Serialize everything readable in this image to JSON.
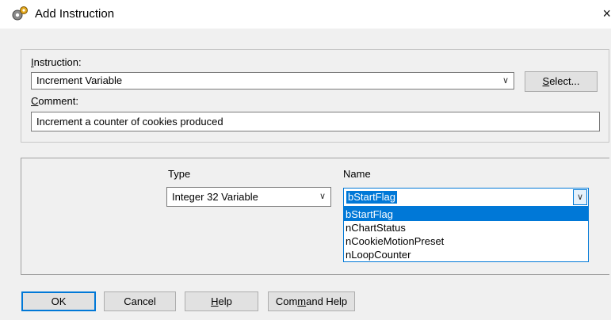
{
  "window": {
    "title": "Add Instruction",
    "close_glyph": "×"
  },
  "instruction": {
    "label_underlined": "I",
    "label_rest": "nstruction:",
    "value": "Increment Variable",
    "select_underlined": "S",
    "select_rest": "elect..."
  },
  "comment": {
    "label_underlined": "C",
    "label_rest": "omment:",
    "value": "Increment a counter of cookies produced"
  },
  "params": {
    "type_header": "Type",
    "name_header": "Name",
    "type_value": "Integer 32 Variable",
    "name_value": "bStartFlag",
    "name_options": [
      "bStartFlag",
      "nChartStatus",
      "nCookieMotionPreset",
      "nLoopCounter"
    ],
    "selected_index": 0
  },
  "footer": {
    "ok": "OK",
    "cancel": "Cancel",
    "help_underlined": "H",
    "help_rest": "elp",
    "cmd_help_a": "Com",
    "cmd_help_underlined": "m",
    "cmd_help_b": "and Help"
  },
  "icons": {
    "app": "gear-icon",
    "arrow": "chevron-down-icon"
  },
  "colors": {
    "accent": "#0078d7",
    "dialog_bg": "#f0f0f0"
  }
}
